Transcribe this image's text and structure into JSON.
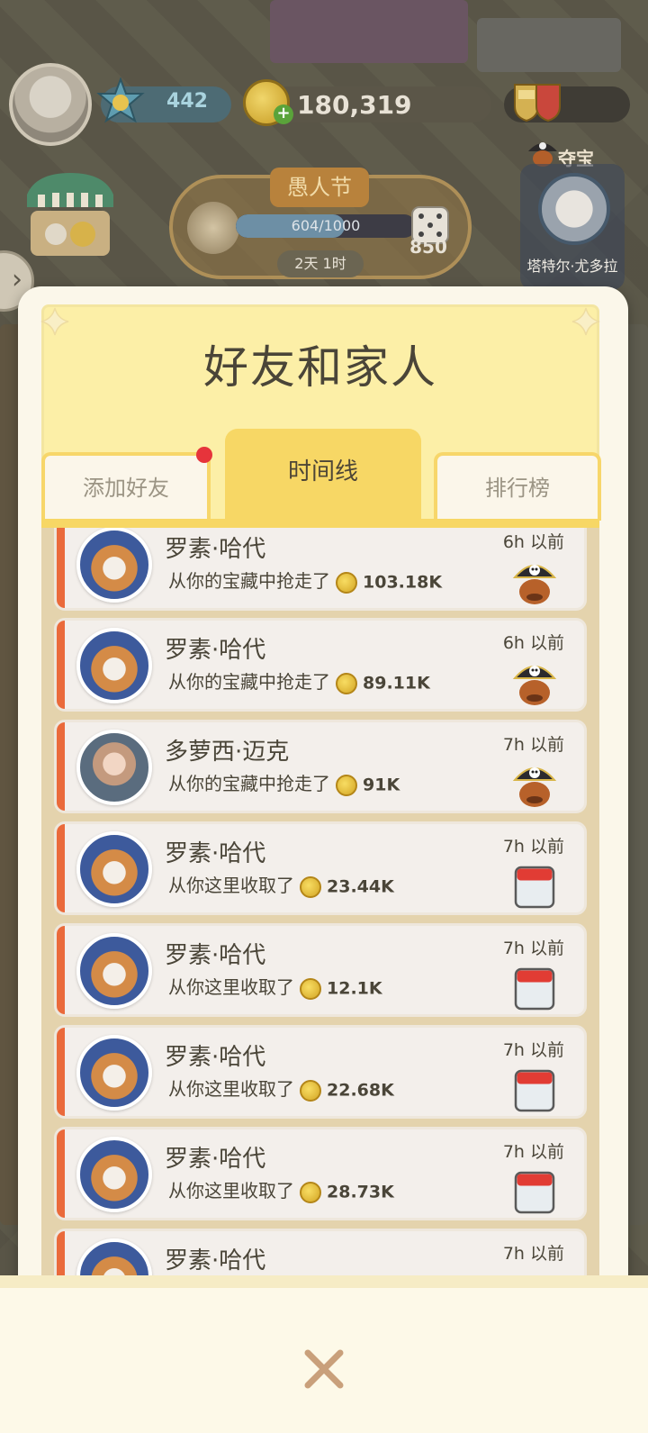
{
  "hud": {
    "level": "442",
    "coins": "180,319",
    "colors": {
      "accent": "#f7d765",
      "stripe": "#ea6a3b",
      "badge": "#e6343b"
    }
  },
  "event": {
    "title": "愚人节",
    "progress_text": "604/1000",
    "progress_fraction": 0.604,
    "dice_count": "850",
    "timer": "2天 1时"
  },
  "raid": {
    "label": "夺宝",
    "target_name": "塔特尔·尤多拉"
  },
  "modal": {
    "title": "好友和家人",
    "tabs": [
      {
        "label": "添加好友",
        "has_badge": true
      },
      {
        "label": "时间线",
        "active": true
      },
      {
        "label": "排行榜"
      }
    ]
  },
  "timeline": [
    {
      "name": "罗素·哈代",
      "action": "从你的宝藏中抢走了",
      "amount": "103.18K",
      "time": "6h 以前",
      "avatar": "corgi-avatar",
      "type_icon": "pirate-icon"
    },
    {
      "name": "罗素·哈代",
      "action": "从你的宝藏中抢走了",
      "amount": "89.11K",
      "time": "6h 以前",
      "avatar": "corgi-avatar",
      "type_icon": "pirate-icon"
    },
    {
      "name": "多萝西·迈克",
      "action": "从你的宝藏中抢走了",
      "amount": "91K",
      "time": "7h 以前",
      "avatar": "girl-avatar",
      "type_icon": "pirate-icon"
    },
    {
      "name": "罗素·哈代",
      "action": "从你这里收取了",
      "amount": "23.44K",
      "time": "7h 以前",
      "avatar": "corgi-avatar",
      "type_icon": "calendar-icon"
    },
    {
      "name": "罗素·哈代",
      "action": "从你这里收取了",
      "amount": "12.1K",
      "time": "7h 以前",
      "avatar": "corgi-avatar",
      "type_icon": "calendar-icon"
    },
    {
      "name": "罗素·哈代",
      "action": "从你这里收取了",
      "amount": "22.68K",
      "time": "7h 以前",
      "avatar": "corgi-avatar",
      "type_icon": "calendar-icon"
    },
    {
      "name": "罗素·哈代",
      "action": "从你这里收取了",
      "amount": "28.73K",
      "time": "7h 以前",
      "avatar": "corgi-avatar",
      "type_icon": "calendar-icon"
    },
    {
      "name": "罗素·哈代",
      "action": "",
      "amount": "",
      "time": "7h 以前",
      "avatar": "corgi-avatar",
      "type_icon": "shield-icon"
    }
  ],
  "footer": {
    "close_icon": "close-icon"
  }
}
